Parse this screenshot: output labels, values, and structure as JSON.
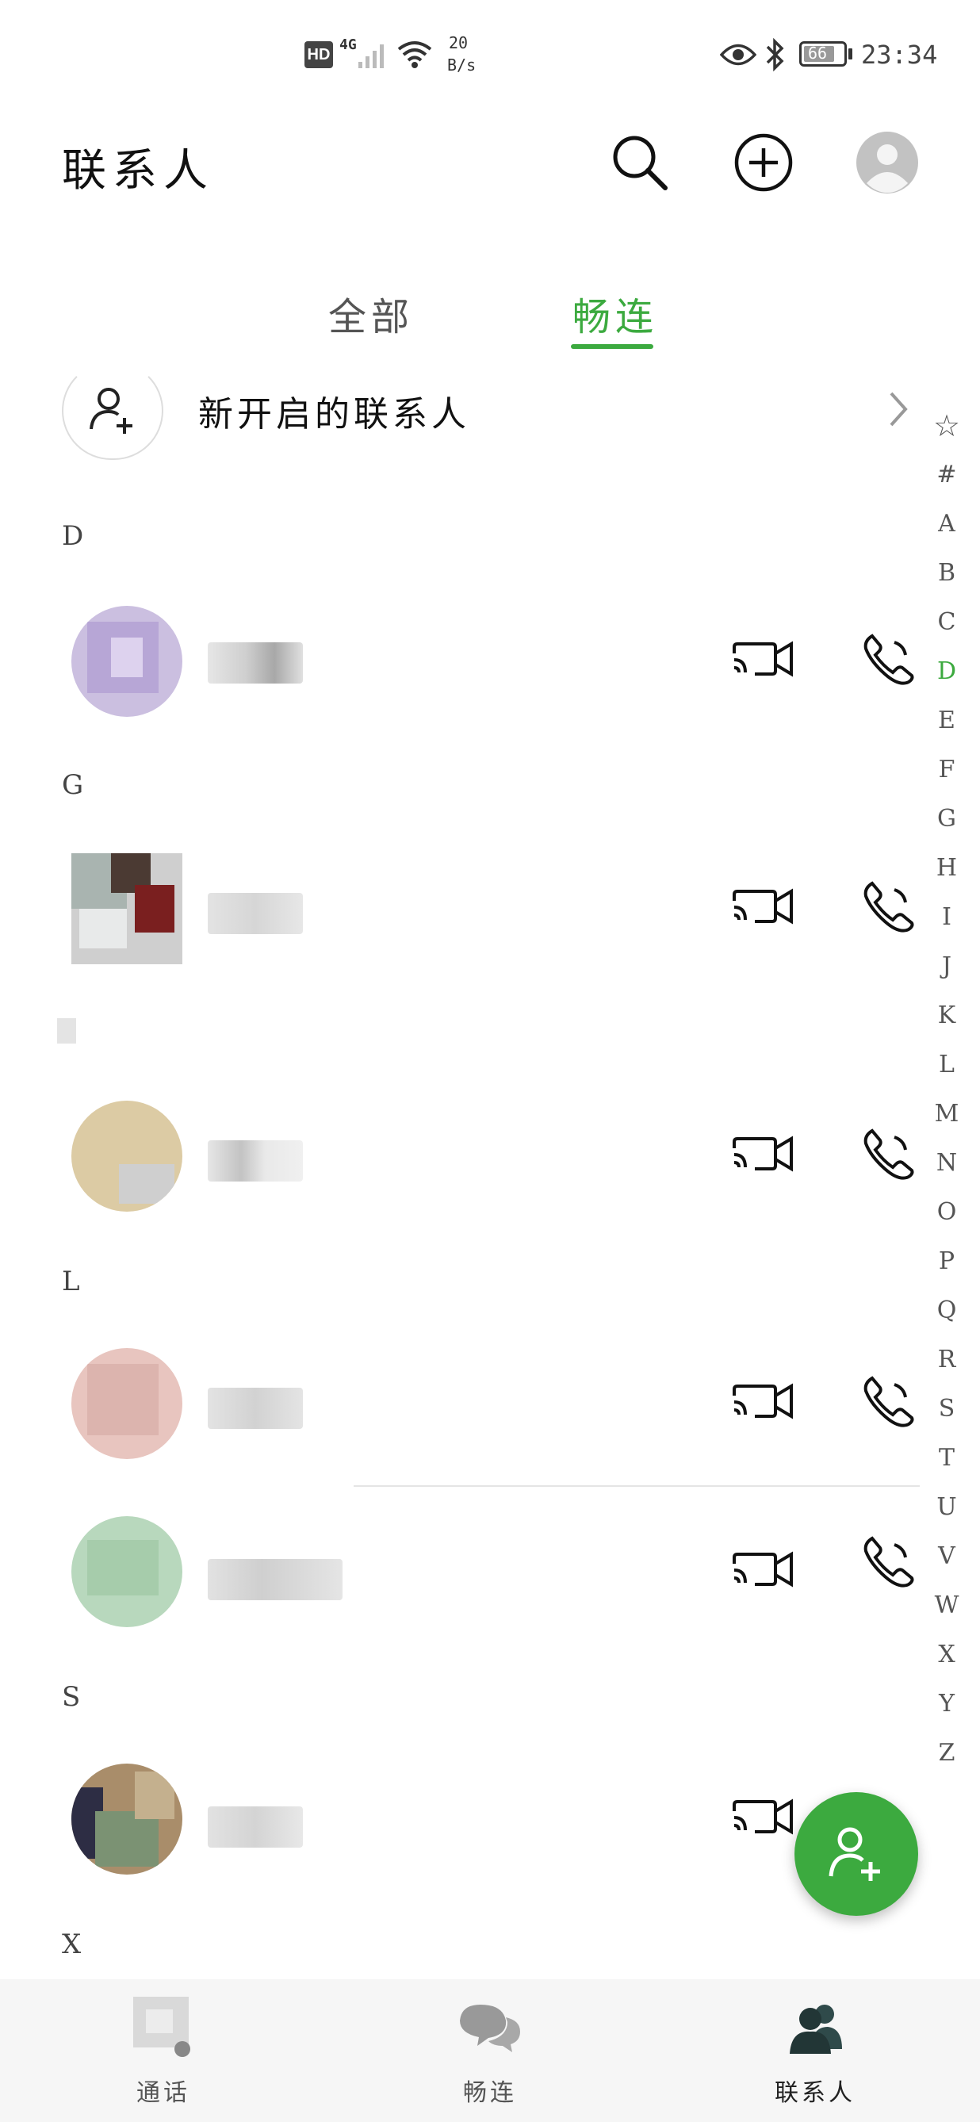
{
  "status_bar": {
    "network": "4G",
    "hd": "HD",
    "speed_value": "20",
    "speed_unit": "B/s",
    "battery": "66",
    "time": "23:34"
  },
  "header": {
    "title": "联系人",
    "icons": [
      "search-icon",
      "add-circle-icon",
      "profile-avatar"
    ]
  },
  "tabs": [
    {
      "label": "全部",
      "active": false
    },
    {
      "label": "畅连",
      "active": true
    }
  ],
  "new_contacts": {
    "label": "新开启的联系人"
  },
  "sections": [
    {
      "letter": "D"
    },
    {
      "letter": "G"
    },
    {
      "letter": "L"
    },
    {
      "letter": "S"
    },
    {
      "letter": "X"
    }
  ],
  "index_bar": {
    "letters": [
      "☆",
      "#",
      "A",
      "B",
      "C",
      "D",
      "E",
      "F",
      "G",
      "H",
      "I",
      "J",
      "K",
      "L",
      "M",
      "N",
      "O",
      "P",
      "Q",
      "R",
      "S",
      "T",
      "U",
      "V",
      "W",
      "X",
      "Y",
      "Z"
    ],
    "active": "D"
  },
  "bottom_nav": [
    {
      "label": "通话",
      "icon": "phone-tab-icon",
      "active": false
    },
    {
      "label": "畅连",
      "icon": "chat-bubbles-icon",
      "active": false
    },
    {
      "label": "联系人",
      "icon": "contacts-icon",
      "active": true
    }
  ],
  "colors": {
    "accent": "#3CAA3F",
    "text": "#111111",
    "nav_bg": "#f6f6f6"
  }
}
